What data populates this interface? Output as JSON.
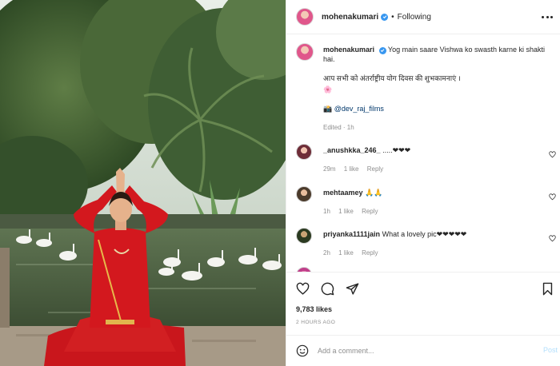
{
  "post": {
    "username": "mohenakumari",
    "follow_status": "Following",
    "separator": "•",
    "photo_icon": "post-photo"
  },
  "caption": {
    "username": "mohenakumari",
    "line1": "Yog main saare Vishwa ko swasth karne ki shakti hai.",
    "line2": "आप सभी को अंतर्राष्ट्रीय योग दिवस की शुभकामनाएं ।",
    "line3": "🌸",
    "tag_prefix": "📸",
    "tag": "@dev_raj_films",
    "edited": "Edited · 1h"
  },
  "comments": [
    {
      "username": "_anushkka_246_",
      "text": ".....❤❤❤",
      "time": "29m",
      "likes": "1 like",
      "reply": "Reply"
    },
    {
      "username": "mehtaamey",
      "text": "🙏🙏",
      "time": "1h",
      "likes": "1 like",
      "reply": "Reply"
    },
    {
      "username": "priyanka1111jain",
      "text": "What a lovely pic❤❤❤❤❤",
      "time": "2h",
      "likes": "1 like",
      "reply": "Reply"
    }
  ],
  "actions": {
    "likes": "9,783 likes",
    "posted": "2 HOURS AGO",
    "icons": [
      "heart-icon",
      "comment-icon",
      "share-icon",
      "save-icon"
    ]
  },
  "add_comment": {
    "placeholder": "Add a comment...",
    "post_label": "Post"
  },
  "colors": {
    "verified_blue": "#3897f0",
    "post_button_disabled": "#b2dffc",
    "link": "#00376b",
    "muted": "#8e8e8e"
  }
}
